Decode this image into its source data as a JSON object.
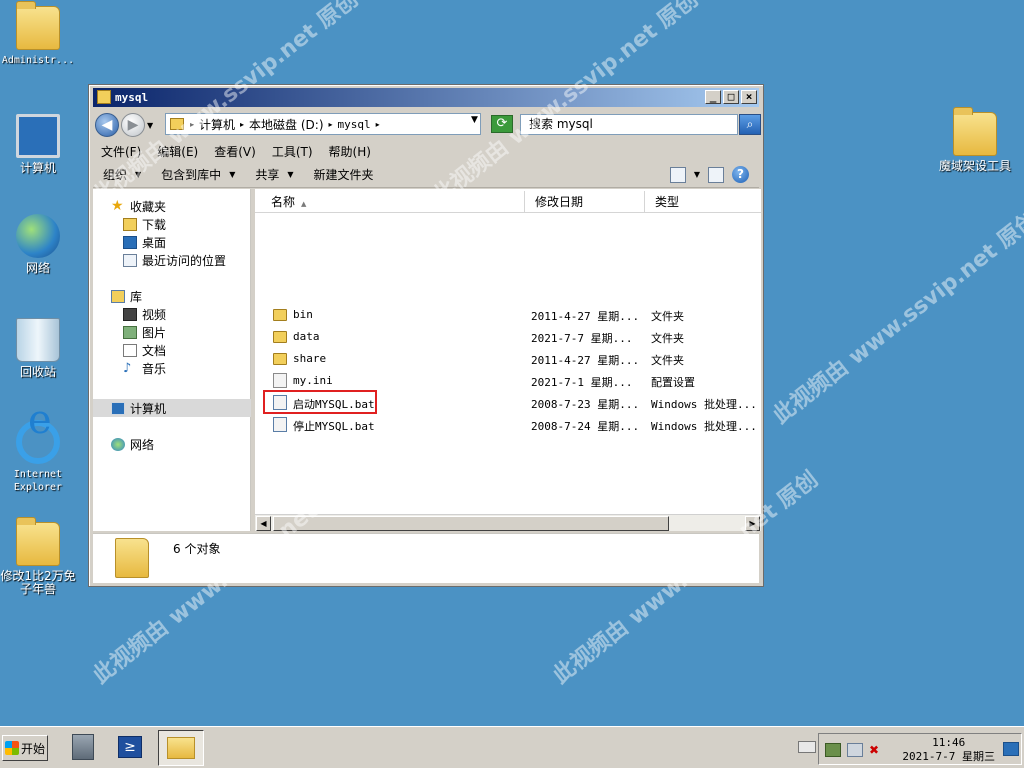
{
  "desktop": {
    "icons": [
      {
        "label": "Administr..."
      },
      {
        "label": "计算机"
      },
      {
        "label": "网络"
      },
      {
        "label": "回收站"
      },
      {
        "label": "Internet Explorer"
      },
      {
        "label": "修改1比2万免子年兽"
      },
      {
        "label": "魔域架设工具"
      }
    ],
    "watermark": "此视频由 www.ssvip.net 原创"
  },
  "window": {
    "title": "mysql",
    "address": {
      "crumbs": [
        "计算机",
        "本地磁盘 (D:)",
        "mysql"
      ]
    },
    "search_placeholder": "搜索 mysql",
    "menu": [
      "文件(F)",
      "编辑(E)",
      "查看(V)",
      "工具(T)",
      "帮助(H)"
    ],
    "toolbar": {
      "organize": "组织",
      "include_library": "包含到库中",
      "share": "共享",
      "new_folder": "新建文件夹"
    },
    "nav": {
      "favorites": "收藏夹",
      "downloads": "下载",
      "desktop": "桌面",
      "recent": "最近访问的位置",
      "libraries": "库",
      "videos": "视频",
      "pictures": "图片",
      "documents": "文档",
      "music": "音乐",
      "computer": "计算机",
      "network": "网络"
    },
    "columns": {
      "name": "名称",
      "modified": "修改日期",
      "type": "类型"
    },
    "files": [
      {
        "name": "bin",
        "modified": "2011-4-27 星期...",
        "type": "文件夹"
      },
      {
        "name": "data",
        "modified": "2021-7-7 星期...",
        "type": "文件夹"
      },
      {
        "name": "share",
        "modified": "2011-4-27 星期...",
        "type": "文件夹"
      },
      {
        "name": "my.ini",
        "modified": "2021-7-1 星期...",
        "type": "配置设置"
      },
      {
        "name": "启动MYSQL.bat",
        "modified": "2008-7-23 星期...",
        "type": "Windows 批处理..."
      },
      {
        "name": "停止MYSQL.bat",
        "modified": "2008-7-24 星期...",
        "type": "Windows 批处理..."
      }
    ],
    "status_count": "6 个对象"
  },
  "taskbar": {
    "start_label": "开始",
    "clock_time": "11:46",
    "clock_date": "2021-7-7 星期三"
  },
  "colors": {
    "desktop_bg": "#4b92c4",
    "highlight_border": "#e02020"
  }
}
